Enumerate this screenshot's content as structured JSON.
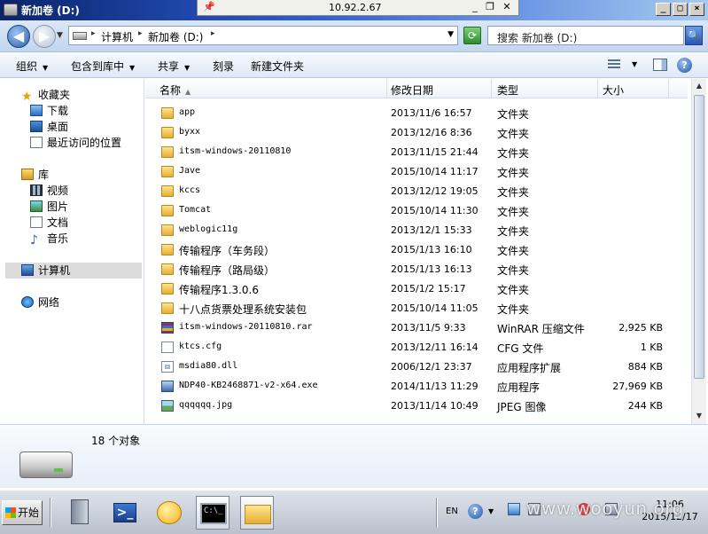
{
  "window": {
    "title": "新加卷 (D:)",
    "remote_address": "10.92.2.67"
  },
  "address_bar": {
    "crumbs": [
      "计算机",
      "新加卷 (D:)"
    ],
    "search_placeholder": "搜索 新加卷 (D:)"
  },
  "toolbar": {
    "organize": "组织",
    "include_in_library": "包含到库中",
    "share": "共享",
    "burn": "刻录",
    "new_folder": "新建文件夹"
  },
  "nav": {
    "favorites": "收藏夹",
    "downloads": "下载",
    "desktop": "桌面",
    "recent": "最近访问的位置",
    "libraries": "库",
    "videos": "视频",
    "pictures": "图片",
    "documents": "文档",
    "music": "音乐",
    "computer": "计算机",
    "network": "网络"
  },
  "columns": {
    "name": "名称",
    "date": "修改日期",
    "type": "类型",
    "size": "大小"
  },
  "files": [
    {
      "name": "app",
      "date": "2013/11/6 16:57",
      "type": "文件夹",
      "size": "",
      "kind": "folder"
    },
    {
      "name": "byxx",
      "date": "2013/12/16 8:36",
      "type": "文件夹",
      "size": "",
      "kind": "folder"
    },
    {
      "name": "itsm-windows-20110810",
      "date": "2013/11/15 21:44",
      "type": "文件夹",
      "size": "",
      "kind": "folder"
    },
    {
      "name": "Jave",
      "date": "2015/10/14 11:17",
      "type": "文件夹",
      "size": "",
      "kind": "folder"
    },
    {
      "name": "kccs",
      "date": "2013/12/12 19:05",
      "type": "文件夹",
      "size": "",
      "kind": "folder"
    },
    {
      "name": "Tomcat",
      "date": "2015/10/14 11:30",
      "type": "文件夹",
      "size": "",
      "kind": "folder"
    },
    {
      "name": "weblogic11g",
      "date": "2013/12/1 15:33",
      "type": "文件夹",
      "size": "",
      "kind": "folder"
    },
    {
      "name": "传输程序（车务段）",
      "date": "2015/1/13 16:10",
      "type": "文件夹",
      "size": "",
      "kind": "folder"
    },
    {
      "name": "传输程序（路局级）",
      "date": "2015/1/13 16:13",
      "type": "文件夹",
      "size": "",
      "kind": "folder"
    },
    {
      "name": "传输程序1.3.0.6",
      "date": "2015/1/2 15:17",
      "type": "文件夹",
      "size": "",
      "kind": "folder"
    },
    {
      "name": "十八点货票处理系统安装包",
      "date": "2015/10/14 11:05",
      "type": "文件夹",
      "size": "",
      "kind": "folder"
    },
    {
      "name": "itsm-windows-20110810.rar",
      "date": "2013/11/5 9:33",
      "type": "WinRAR 压缩文件",
      "size": "2,925 KB",
      "kind": "rar"
    },
    {
      "name": "ktcs.cfg",
      "date": "2013/12/11 16:14",
      "type": "CFG 文件",
      "size": "1 KB",
      "kind": "cfg"
    },
    {
      "name": "msdia80.dll",
      "date": "2006/12/1 23:37",
      "type": "应用程序扩展",
      "size": "884 KB",
      "kind": "dll"
    },
    {
      "name": "NDP40-KB2468871-v2-x64.exe",
      "date": "2014/11/13 11:29",
      "type": "应用程序",
      "size": "27,969 KB",
      "kind": "exe"
    },
    {
      "name": "qqqqqq.jpg",
      "date": "2013/11/14 10:49",
      "type": "JPEG 图像",
      "size": "244 KB",
      "kind": "jpg"
    }
  ],
  "details": {
    "count": "18 个对象"
  },
  "taskbar": {
    "start": "开始",
    "lang": "EN",
    "time": "11:06",
    "date": "2015/12/17"
  },
  "watermark": "www.wooyun.org",
  "colors": {
    "titlebar_start": "#0a246a",
    "titlebar_end": "#a6caf0",
    "selection": "#dcdcdc"
  }
}
